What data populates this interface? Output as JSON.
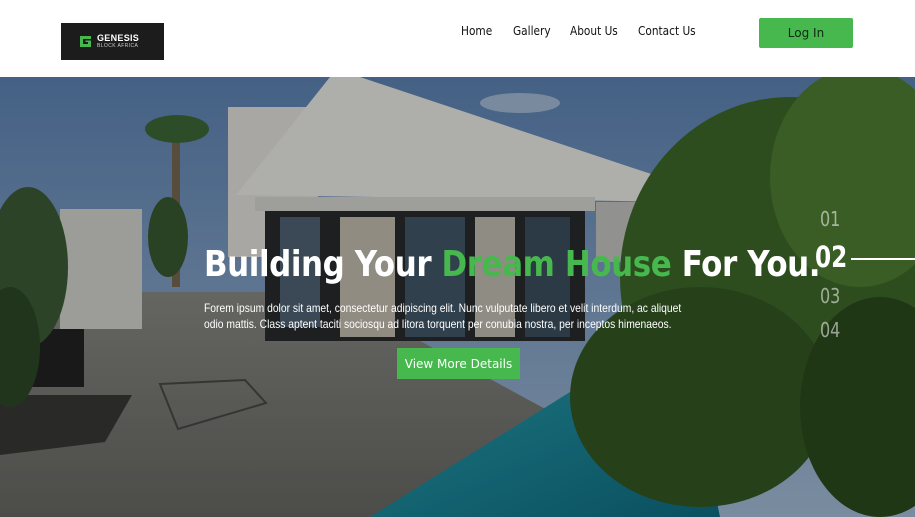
{
  "brand": {
    "name": "GENESIS",
    "subtitle": "BLOCK AFRICA",
    "accent": "#46b84e"
  },
  "nav": {
    "items": [
      {
        "label": "Home"
      },
      {
        "label": "Gallery"
      },
      {
        "label": "About Us"
      },
      {
        "label": "Contact Us"
      }
    ],
    "login_label": "Log In"
  },
  "hero": {
    "title_prefix": "Building Your ",
    "title_accent": "Dream House",
    "title_suffix": " For You.",
    "text": "Forem ipsum dolor sit amet, consectetur adipiscing elit. Nunc vulputate libero et velit interdum, ac aliquet odio mattis. Class aptent taciti sociosqu ad litora torquent per conubia nostra, per inceptos himenaeos.",
    "cta_label": "View More Details"
  },
  "slider": {
    "items": [
      {
        "label": "01"
      },
      {
        "label": "02"
      },
      {
        "label": "03"
      },
      {
        "label": "04"
      }
    ],
    "active_index": 1
  }
}
